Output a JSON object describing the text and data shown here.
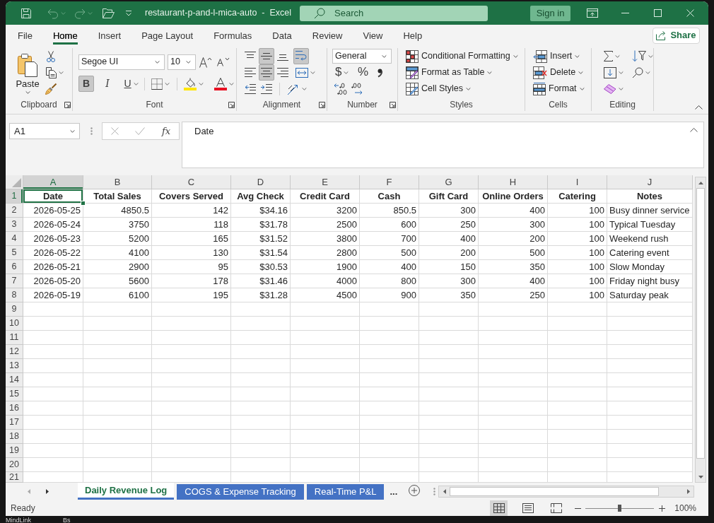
{
  "window": {
    "title": "restaurant-p-and-l-mica-auto  -  Excel"
  },
  "title_bar": {
    "search_placeholder": "Search",
    "sign_in": "Sign in"
  },
  "ribbon_tabs": [
    {
      "label": "File",
      "selected": false
    },
    {
      "label": "Home",
      "selected": true
    },
    {
      "label": "Insert",
      "selected": false
    },
    {
      "label": "Page Layout",
      "selected": false
    },
    {
      "label": "Formulas",
      "selected": false
    },
    {
      "label": "Data",
      "selected": false
    },
    {
      "label": "Review",
      "selected": false
    },
    {
      "label": "View",
      "selected": false
    },
    {
      "label": "Help",
      "selected": false
    }
  ],
  "share_button": "Share",
  "ribbon": {
    "clipboard": {
      "paste": "Paste",
      "label": "Clipboard"
    },
    "font": {
      "family": "Segoe UI",
      "size": "10",
      "styles": [
        {
          "kind": "bold",
          "label": "B",
          "on": true
        },
        {
          "kind": "italic",
          "label": "I",
          "on": false
        },
        {
          "kind": "underline",
          "label": "U",
          "on": false
        }
      ],
      "label": "Font"
    },
    "alignment": {
      "vertical": [
        {
          "kind": "top",
          "on": false
        },
        {
          "kind": "middle",
          "on": true
        },
        {
          "kind": "bottom",
          "on": false
        }
      ],
      "horizontal": [
        {
          "kind": "left",
          "on": false
        },
        {
          "kind": "center",
          "on": true
        },
        {
          "kind": "right",
          "on": false
        }
      ],
      "wrap_text": {
        "on": true
      },
      "label": "Alignment"
    },
    "number": {
      "format": "General",
      "currency": "$",
      "percent": "%",
      "label": "Number"
    },
    "styles": {
      "items": [
        {
          "kind": "conditional_formatting",
          "label": "Conditional Formatting"
        },
        {
          "kind": "format_as_table",
          "label": "Format as Table"
        },
        {
          "kind": "cell_styles",
          "label": "Cell Styles"
        }
      ],
      "label": "Styles"
    },
    "cells": {
      "items": [
        {
          "kind": "insert",
          "label": "Insert"
        },
        {
          "kind": "delete",
          "label": "Delete"
        },
        {
          "kind": "format",
          "label": "Format"
        }
      ],
      "label": "Cells"
    },
    "editing": {
      "label": "Editing"
    }
  },
  "formula_bar": {
    "name_box": "A1",
    "function_label": "fx",
    "formula": "Date"
  },
  "sheet": {
    "columns": [
      {
        "letter": "A",
        "selected": true,
        "kind": "number"
      },
      {
        "letter": "B",
        "selected": false,
        "kind": "number"
      },
      {
        "letter": "C",
        "selected": false,
        "kind": "number"
      },
      {
        "letter": "D",
        "selected": false,
        "kind": "number"
      },
      {
        "letter": "E",
        "selected": false,
        "kind": "number"
      },
      {
        "letter": "F",
        "selected": false,
        "kind": "number"
      },
      {
        "letter": "G",
        "selected": false,
        "kind": "number"
      },
      {
        "letter": "H",
        "selected": false,
        "kind": "number"
      },
      {
        "letter": "I",
        "selected": false,
        "kind": "number"
      },
      {
        "letter": "J",
        "selected": false,
        "kind": "text"
      }
    ],
    "rows": [
      {
        "number": "1",
        "selected": true,
        "kind": "header",
        "cells": [
          "Date",
          "Total Sales",
          "Covers Served",
          "Avg Check",
          "Credit Card",
          "Cash",
          "Gift Card",
          "Online Orders",
          "Catering",
          "Notes"
        ]
      },
      {
        "number": "2",
        "selected": false,
        "kind": "data",
        "cells": [
          "2026-05-25",
          "4850.5",
          "142",
          "$34.16",
          "3200",
          "850.5",
          "300",
          "400",
          "100",
          "Busy dinner service"
        ]
      },
      {
        "number": "3",
        "selected": false,
        "kind": "data",
        "cells": [
          "2026-05-24",
          "3750",
          "118",
          "$31.78",
          "2500",
          "600",
          "250",
          "300",
          "100",
          "Typical Tuesday"
        ]
      },
      {
        "number": "4",
        "selected": false,
        "kind": "data",
        "cells": [
          "2026-05-23",
          "5200",
          "165",
          "$31.52",
          "3800",
          "700",
          "400",
          "200",
          "100",
          "Weekend rush"
        ]
      },
      {
        "number": "5",
        "selected": false,
        "kind": "data",
        "cells": [
          "2026-05-22",
          "4100",
          "130",
          "$31.54",
          "2800",
          "500",
          "200",
          "500",
          "100",
          "Catering event"
        ]
      },
      {
        "number": "6",
        "selected": false,
        "kind": "data",
        "cells": [
          "2026-05-21",
          "2900",
          "95",
          "$30.53",
          "1900",
          "400",
          "150",
          "350",
          "100",
          "Slow Monday"
        ]
      },
      {
        "number": "7",
        "selected": false,
        "kind": "data",
        "cells": [
          "2026-05-20",
          "5600",
          "178",
          "$31.46",
          "4000",
          "800",
          "300",
          "400",
          "100",
          "Friday night busy"
        ]
      },
      {
        "number": "8",
        "selected": false,
        "kind": "data",
        "cells": [
          "2026-05-19",
          "6100",
          "195",
          "$31.28",
          "4500",
          "900",
          "350",
          "250",
          "100",
          "Saturday peak"
        ]
      },
      {
        "number": "9",
        "selected": false,
        "kind": "empty"
      },
      {
        "number": "10",
        "selected": false,
        "kind": "empty"
      },
      {
        "number": "11",
        "selected": false,
        "kind": "empty"
      },
      {
        "number": "12",
        "selected": false,
        "kind": "empty"
      },
      {
        "number": "13",
        "selected": false,
        "kind": "empty"
      },
      {
        "number": "14",
        "selected": false,
        "kind": "empty"
      },
      {
        "number": "15",
        "selected": false,
        "kind": "empty"
      },
      {
        "number": "16",
        "selected": false,
        "kind": "empty"
      },
      {
        "number": "17",
        "selected": false,
        "kind": "empty"
      },
      {
        "number": "18",
        "selected": false,
        "kind": "empty"
      },
      {
        "number": "19",
        "selected": false,
        "kind": "empty"
      },
      {
        "number": "20",
        "selected": false,
        "kind": "empty"
      },
      {
        "number": "21",
        "selected": false,
        "kind": "empty"
      }
    ]
  },
  "sheet_tabs": {
    "tabs": [
      {
        "label": "Daily Revenue Log",
        "selected": true,
        "color": "#4472c4"
      },
      {
        "label": "COGS & Expense Tracking",
        "selected": false,
        "color": "#4472c4"
      },
      {
        "label": "Real-Time P&L",
        "selected": false,
        "color": "#4472c4"
      }
    ],
    "more": "..."
  },
  "status_bar": {
    "status": "Ready",
    "views": [
      {
        "kind": "normal",
        "selected": true
      },
      {
        "kind": "page_layout",
        "selected": false
      },
      {
        "kind": "page_break_preview",
        "selected": false
      }
    ],
    "zoom": {
      "level": 0.5,
      "reading": "100%"
    }
  },
  "desktop": {
    "labels": [
      "MindLink",
      "Bs"
    ]
  }
}
